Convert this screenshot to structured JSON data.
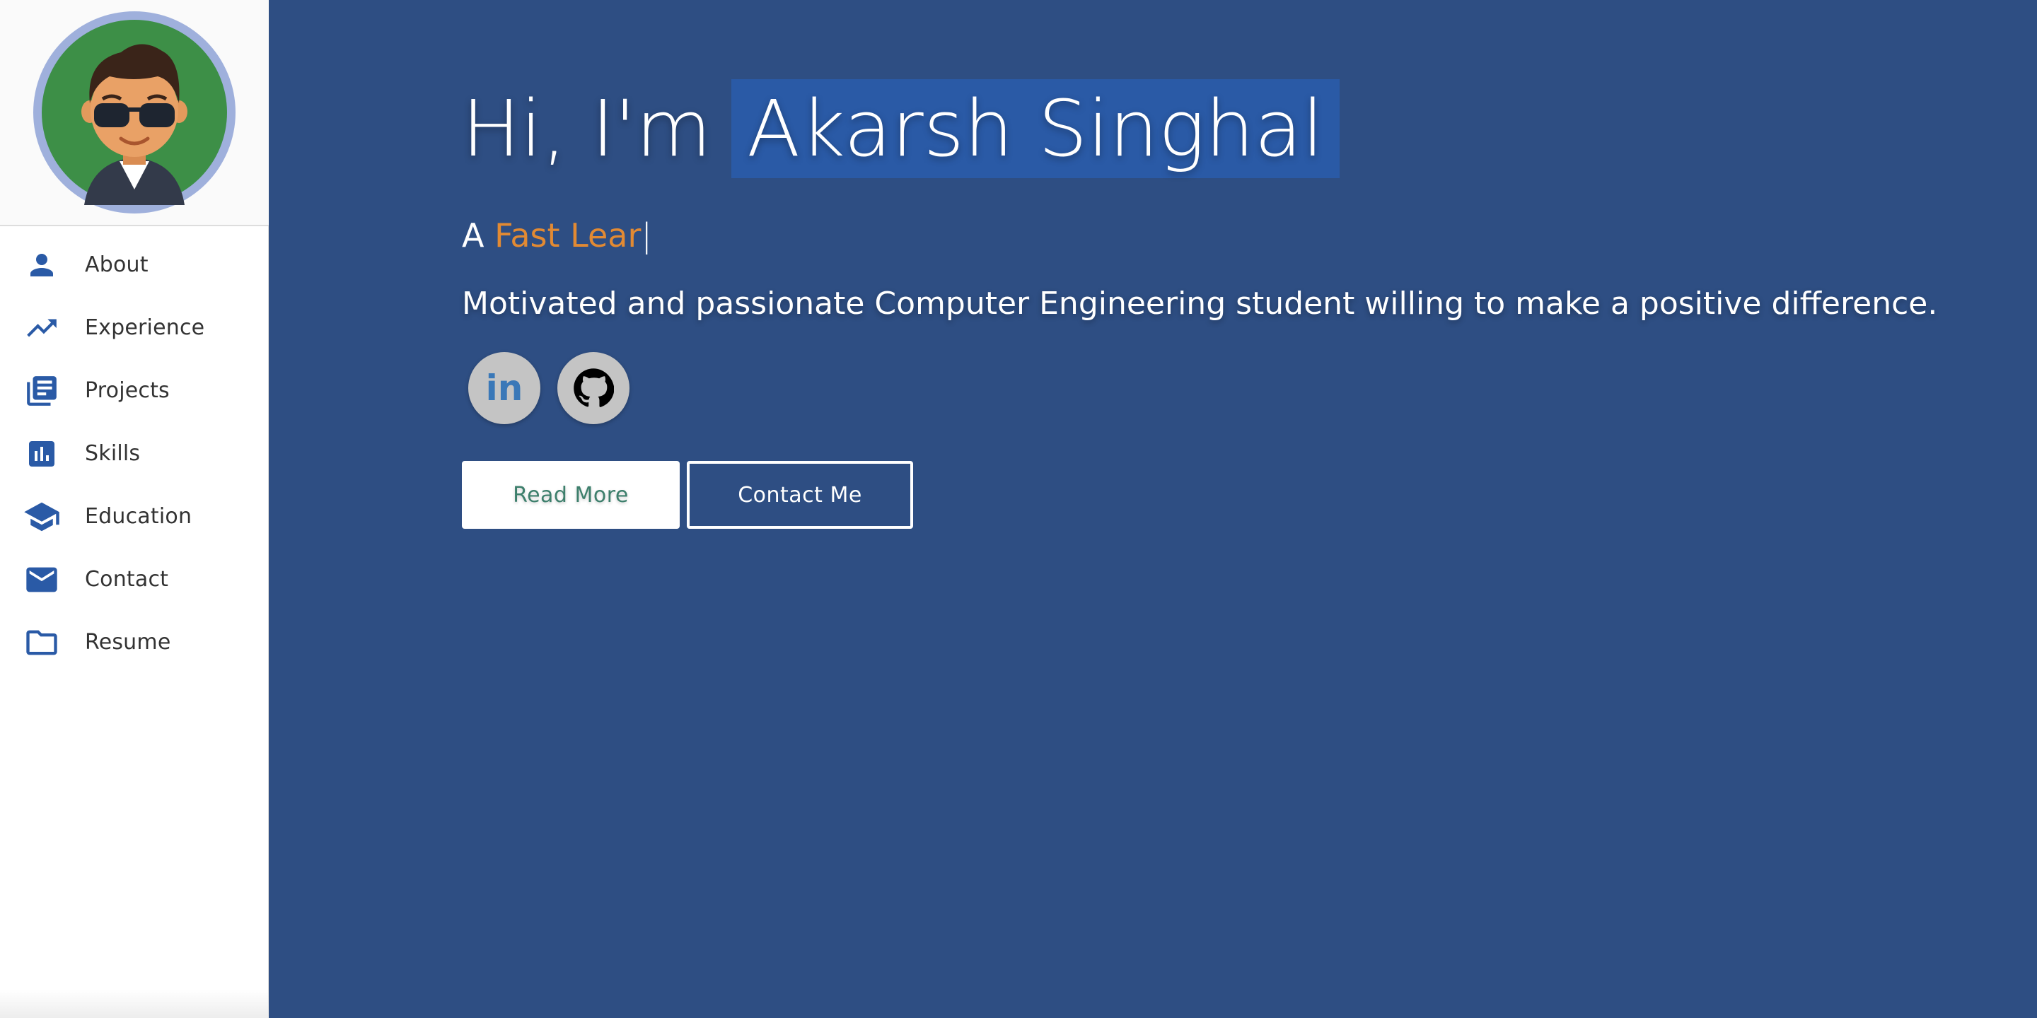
{
  "colors": {
    "main_bg": "#2e4e83",
    "name_highlight": "#2a5aa6",
    "accent_orange": "#e28a33",
    "nav_icon": "#2a5aa6",
    "sidebar_bg": "#ffffff"
  },
  "sidebar": {
    "avatar_icon": "avatar-image",
    "items": [
      {
        "icon": "person-icon",
        "label": "About"
      },
      {
        "icon": "trending-up-icon",
        "label": "Experience"
      },
      {
        "icon": "library-books-icon",
        "label": "Projects"
      },
      {
        "icon": "bar-chart-icon",
        "label": "Skills"
      },
      {
        "icon": "school-icon",
        "label": "Education"
      },
      {
        "icon": "mail-icon",
        "label": "Contact"
      },
      {
        "icon": "folder-icon",
        "label": "Resume"
      }
    ]
  },
  "hero": {
    "prefix": "Hi, I'm",
    "name": "Akarsh Singhal",
    "typing_prefix": "A",
    "typing_word": "Fast Lear",
    "typing_caret": "|",
    "tagline": "Motivated and passionate Computer Engineering student willing to make a positive difference.",
    "socials": [
      {
        "icon": "linkedin-icon",
        "label": "in"
      },
      {
        "icon": "github-icon"
      }
    ],
    "buttons": {
      "read_more": "Read More",
      "contact_me": "Contact Me"
    }
  }
}
